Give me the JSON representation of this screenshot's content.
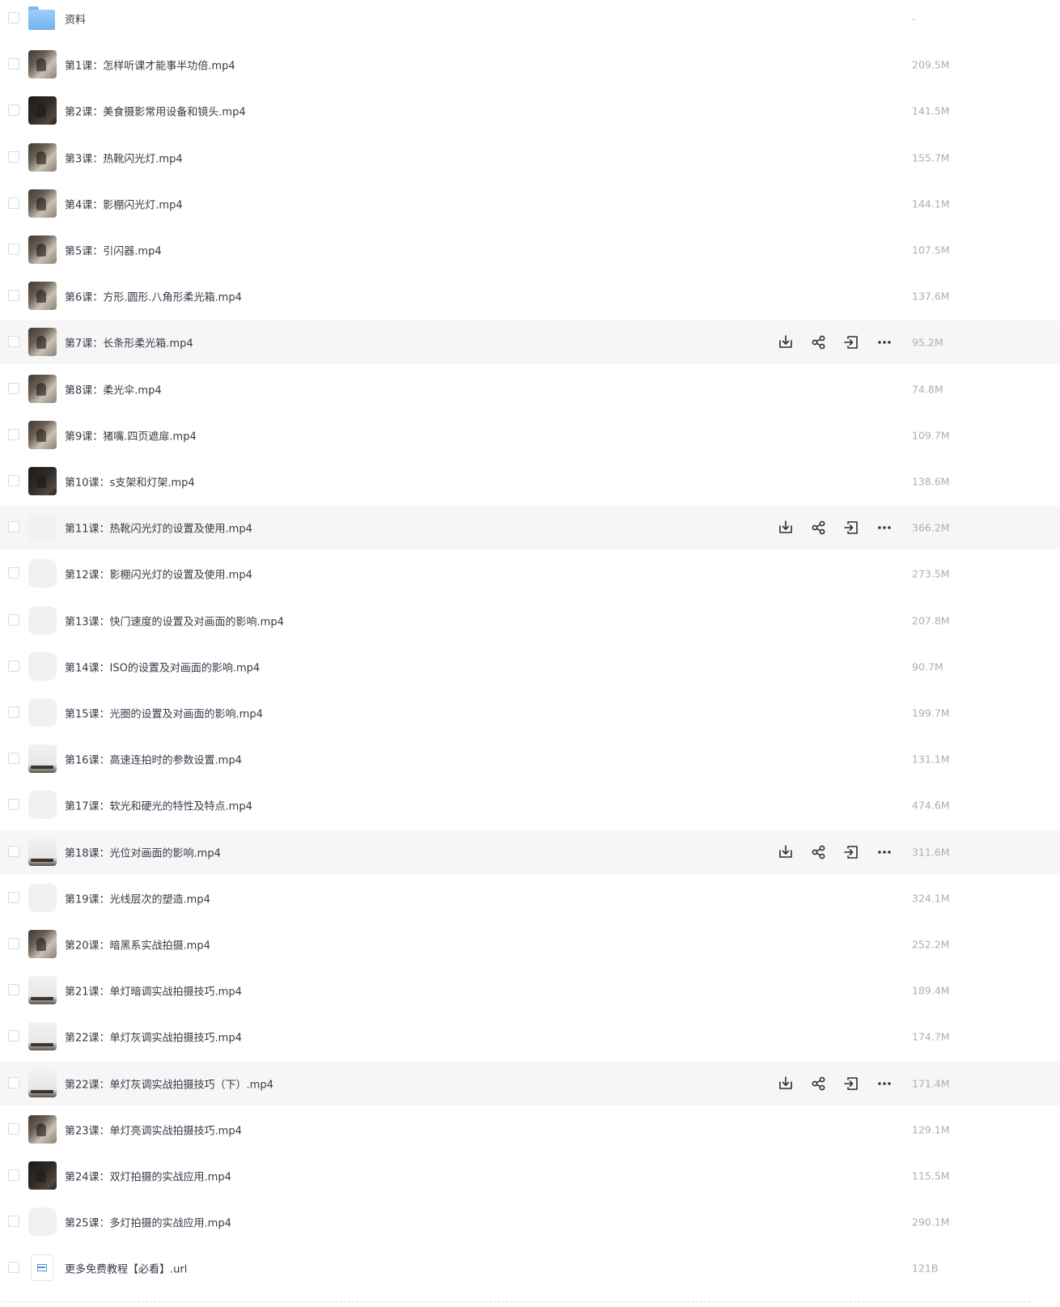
{
  "files": [
    {
      "name": "资料",
      "size": "-",
      "thumb": "folder",
      "hover": false
    },
    {
      "name": "第1课：怎样听课才能事半功倍.mp4",
      "size": "209.5M",
      "thumb": "video",
      "hover": false
    },
    {
      "name": "第2课：美食摄影常用设备和镜头.mp4",
      "size": "141.5M",
      "thumb": "video-dark",
      "hover": false
    },
    {
      "name": "第3课：热靴闪光灯.mp4",
      "size": "155.7M",
      "thumb": "video",
      "hover": false
    },
    {
      "name": "第4课：影棚闪光灯.mp4",
      "size": "144.1M",
      "thumb": "video",
      "hover": false
    },
    {
      "name": "第5课：引闪器.mp4",
      "size": "107.5M",
      "thumb": "video",
      "hover": false
    },
    {
      "name": "第6课：方形.圆形.八角形柔光箱.mp4",
      "size": "137.6M",
      "thumb": "video",
      "hover": false
    },
    {
      "name": "第7课：长条形柔光箱.mp4",
      "size": "95.2M",
      "thumb": "video",
      "hover": true
    },
    {
      "name": "第8课：柔光伞.mp4",
      "size": "74.8M",
      "thumb": "video",
      "hover": false
    },
    {
      "name": "第9课：猪嘴.四页遮扉.mp4",
      "size": "109.7M",
      "thumb": "video",
      "hover": false
    },
    {
      "name": "第10课：s支架和灯架.mp4",
      "size": "138.6M",
      "thumb": "video-dark",
      "hover": false
    },
    {
      "name": "第11课：热靴闪光灯的设置及使用.mp4",
      "size": "366.2M",
      "thumb": "blank",
      "hover": true
    },
    {
      "name": "第12课：影棚闪光灯的设置及使用.mp4",
      "size": "273.5M",
      "thumb": "blank",
      "hover": false
    },
    {
      "name": "第13课：快门速度的设置及对画面的影响.mp4",
      "size": "207.8M",
      "thumb": "blank",
      "hover": false
    },
    {
      "name": "第14课：ISO的设置及对画面的影响.mp4",
      "size": "90.7M",
      "thumb": "blank",
      "hover": false
    },
    {
      "name": "第15课：光圈的设置及对画面的影响.mp4",
      "size": "199.7M",
      "thumb": "blank",
      "hover": false
    },
    {
      "name": "第16课：高速连拍时的参数设置.mp4",
      "size": "131.1M",
      "thumb": "video-light",
      "hover": false
    },
    {
      "name": "第17课：软光和硬光的特性及特点.mp4",
      "size": "474.6M",
      "thumb": "blank",
      "hover": false
    },
    {
      "name": "第18课：光位对画面的影响.mp4",
      "size": "311.6M",
      "thumb": "video-light",
      "hover": true
    },
    {
      "name": "第19课：光线层次的塑造.mp4",
      "size": "324.1M",
      "thumb": "blank",
      "hover": false
    },
    {
      "name": "第20课：暗黑系实战拍摄.mp4",
      "size": "252.2M",
      "thumb": "video",
      "hover": false
    },
    {
      "name": "第21课：单灯暗调实战拍摄技巧.mp4",
      "size": "189.4M",
      "thumb": "video-light",
      "hover": false
    },
    {
      "name": "第22课：单灯灰调实战拍摄技巧.mp4",
      "size": "174.7M",
      "thumb": "video-light",
      "hover": false
    },
    {
      "name": "第22课：单灯灰调实战拍摄技巧（下）.mp4",
      "size": "171.4M",
      "thumb": "video-light",
      "hover": true
    },
    {
      "name": "第23课：单灯亮调实战拍摄技巧.mp4",
      "size": "129.1M",
      "thumb": "video",
      "hover": false
    },
    {
      "name": "第24课：双灯拍摄的实战应用.mp4",
      "size": "115.5M",
      "thumb": "video-dark",
      "hover": false
    },
    {
      "name": "第25课：多灯拍摄的实战应用.mp4",
      "size": "290.1M",
      "thumb": "blank",
      "hover": false
    },
    {
      "name": "更多免费教程【必看】.url",
      "size": "121B",
      "thumb": "url",
      "hover": false
    }
  ],
  "row_actions": [
    {
      "icon": "download-icon"
    },
    {
      "icon": "share-icon"
    },
    {
      "icon": "move-icon"
    },
    {
      "icon": "more-icon"
    }
  ]
}
